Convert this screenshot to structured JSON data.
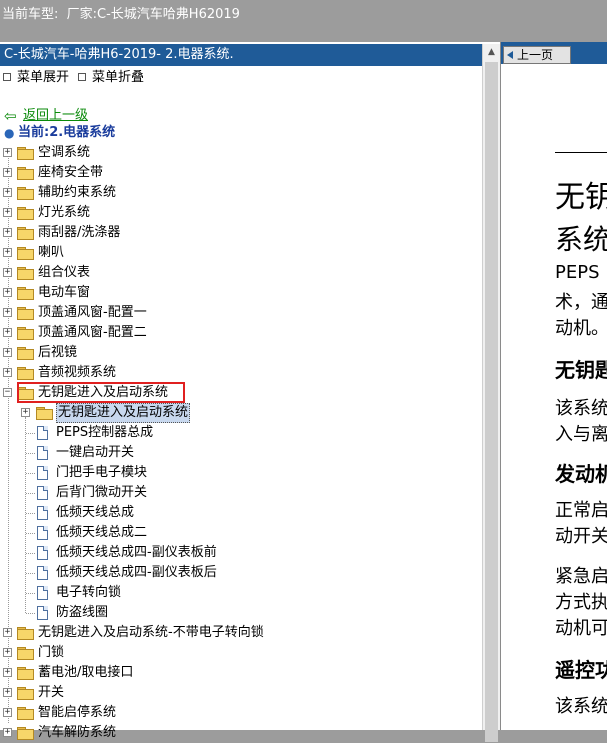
{
  "topbar": {
    "vehicle": "当前车型:  厂家:C-长城汽车哈弗H62019"
  },
  "left": {
    "header": "C-长城汽车-哈弗H6-2019- 2.电器系统.",
    "menu_expand": "菜单展开",
    "menu_collapse": "菜单折叠",
    "back": "返回上一级",
    "current": "当前:2.电器系统",
    "tree_top": [
      "空调系统",
      "座椅安全带",
      "辅助约束系统",
      "灯光系统",
      "雨刮器/洗涤器",
      "喇叭",
      "组合仪表",
      "电动车窗",
      "顶盖通风窗-配置一",
      "顶盖通风窗-配置二",
      "后视镜",
      "音频视频系统"
    ],
    "tree_selected": "无钥匙进入及启动系统",
    "sub_folder": "无钥匙进入及启动系统",
    "sub_docs": [
      "PEPS控制器总成",
      "一键启动开关",
      "门把手电子模块",
      "后背门微动开关",
      "低频天线总成",
      "低频天线总成二",
      "低频天线总成四-副仪表板前",
      "低频天线总成四-副仪表板后",
      "电子转向锁",
      "防盗线圈"
    ],
    "tree_bottom": [
      "无钥匙进入及启动系统-不带电子转向锁",
      "门锁",
      "蓄电池/取电接口",
      "开关",
      "智能启停系统",
      "汽车解防系统"
    ]
  },
  "right": {
    "prev_button": "上一页",
    "lines": [
      "无钥",
      "系统",
      "PEPS",
      "术，通",
      "动机。",
      "无钥匙",
      "该系统",
      "入与离",
      "发动机",
      "正常启",
      "动开关",
      "紧急启",
      "方式执",
      "动机可",
      "遥控功",
      "该系统"
    ]
  },
  "colors": {
    "header_blue": "#1f5b98",
    "selection_red": "#e02020",
    "link_green": "#0a8a0a"
  }
}
